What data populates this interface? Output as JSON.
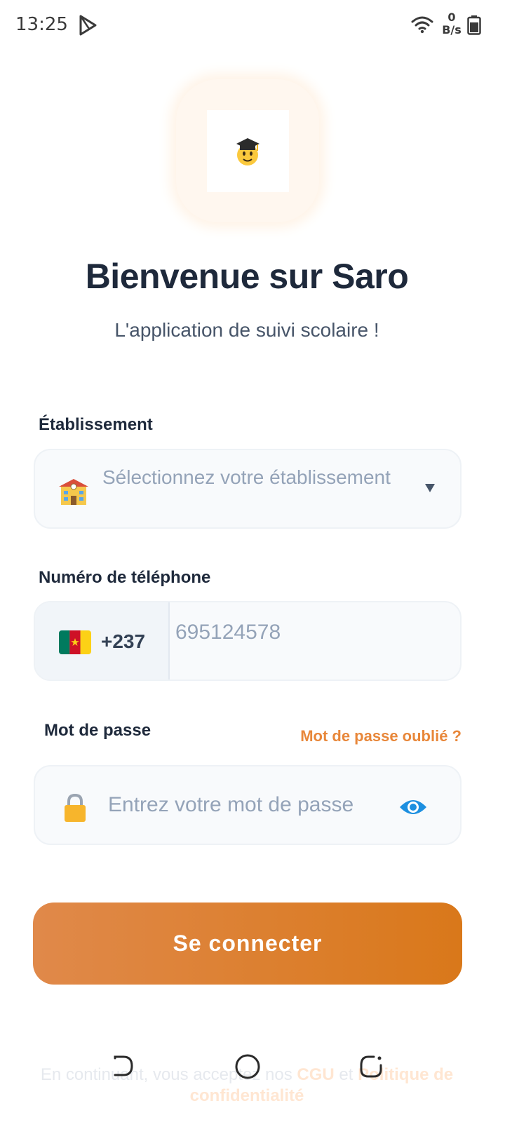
{
  "status_bar": {
    "time": "13:25",
    "net_speed_value": "0",
    "net_speed_unit": "B/s",
    "icons": [
      "play-store-icon",
      "wifi-icon",
      "battery-icon"
    ]
  },
  "header": {
    "logo_icon": "student-graduation-cap-emoji",
    "title": "Bienvenue sur Saro",
    "subtitle": "L'application de suivi scolaire !"
  },
  "form": {
    "school": {
      "label": "Établissement",
      "placeholder": "Sélectionnez votre établissement",
      "icon": "school-building-icon"
    },
    "phone": {
      "label": "Numéro de téléphone",
      "country_code": "+237",
      "country_flag": "cameroon-flag-icon",
      "placeholder": "695124578"
    },
    "password": {
      "label": "Mot de passe",
      "forgot_label": "Mot de passe oublié ?",
      "placeholder": "Entrez votre mot de passe",
      "icon": "lock-icon",
      "toggle_icon": "eye-icon"
    },
    "submit_label": "Se connecter"
  },
  "footer": {
    "terms_prefix": "En continuant, vous acceptez nos ",
    "terms_link_cgu": "CGU",
    "terms_middle": " et ",
    "terms_link_privacy": "Politique de confidentialité"
  },
  "colors": {
    "accent": "#e8873a",
    "button_start": "#e0894a",
    "button_end": "#d9781a",
    "title": "#1e293b",
    "placeholder": "#94a3b8",
    "input_bg": "#f8fafc"
  }
}
